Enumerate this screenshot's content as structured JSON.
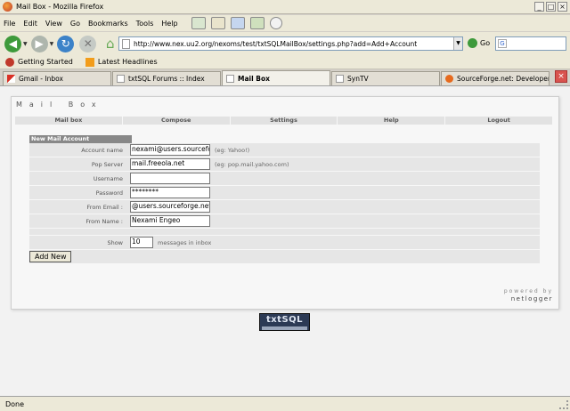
{
  "window": {
    "title": "Mail Box - Mozilla Firefox",
    "controls": [
      "_",
      "□",
      "×"
    ]
  },
  "menu": [
    "File",
    "Edit",
    "View",
    "Go",
    "Bookmarks",
    "Tools",
    "Help"
  ],
  "address": {
    "url": "http://www.nex.uu2.org/nexoms/test/txtSQLMailBox/settings.php?add=Add+Account",
    "go_label": "Go",
    "search_glyph": "G"
  },
  "bookmarks": [
    "Getting Started",
    "Latest Headlines"
  ],
  "tabs": [
    {
      "label": "Gmail - Inbox",
      "icon": "gmail-icon"
    },
    {
      "label": "txtSQL Forums :: Index",
      "icon": "page-icon"
    },
    {
      "label": "Mail Box",
      "icon": "page-icon",
      "active": true
    },
    {
      "label": "SynTV",
      "icon": "page-icon"
    },
    {
      "label": "SourceForge.net: Developer Pr...",
      "icon": "sourceforge-icon"
    }
  ],
  "tab_close": "×",
  "page": {
    "title": "Mail Box",
    "nav": [
      "Mail box",
      "Compose",
      "Settings",
      "Help",
      "Logout"
    ],
    "form_header": "New Mail Account",
    "fields": [
      {
        "label": "Account name",
        "value": "nexami@users.sourcefo",
        "hint": "(eg: Yahoo!)"
      },
      {
        "label": "Pop Server",
        "value": "mail.freeola.net",
        "hint": "(eg: pop.mail.yahoo.com)"
      },
      {
        "label": "Username",
        "value": "",
        "hint": ""
      },
      {
        "label": "Password",
        "value": "********",
        "hint": ""
      },
      {
        "label": "From Email :",
        "value": "@users.sourceforge.net",
        "hint": ""
      },
      {
        "label": "From Name :",
        "value": "Nexami Engeo",
        "hint": ""
      }
    ],
    "show": {
      "label": "Show",
      "value": "10",
      "suffix": "messages in inbox"
    },
    "add_button": "Add New",
    "powered_by": "powered by",
    "powered_brand": "netlogger",
    "logo_text": "txtSQL"
  },
  "status": "Done",
  "colors": {
    "chrome": "#ece9d8",
    "panel": "#f7f7f7",
    "row": "#e6e6e6",
    "header": "#888888"
  }
}
